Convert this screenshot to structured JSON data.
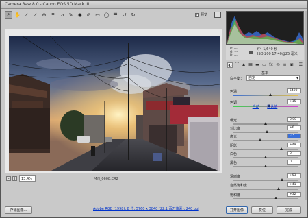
{
  "window": {
    "title": "Camera Raw 8.0  -  Canon EOS 5D Mark III"
  },
  "toolbar": {
    "tools": [
      "zoom-icon",
      "hand-icon",
      "white-balance-icon",
      "color-sampler-icon",
      "target-adjust-icon",
      "crop-icon",
      "straighten-icon",
      "spot-removal-icon",
      "red-eye-icon",
      "adjustment-brush-icon",
      "graduated-filter-icon",
      "radial-filter-icon",
      "preferences-icon",
      "rotate-left-icon",
      "rotate-right-icon"
    ],
    "preview_label": "预览",
    "preview_checked": "✓"
  },
  "preview": {
    "zoom": "13.4%",
    "zoom_minus": "-",
    "zoom_plus": "+",
    "filename": "MYJ_0608.CR2"
  },
  "readout": {
    "r": "R: ---",
    "g": "G: ---",
    "b": "B: ---",
    "line1": "f/4   1/640 秒",
    "line2": "ISO 200   17-40@25 毫米"
  },
  "panel": {
    "menu_icon": "☰",
    "title": "基本",
    "wb_label": "白平衡：",
    "wb_value": "自定",
    "links": {
      "auto": "自动",
      "default": "默认值"
    },
    "sliders": [
      {
        "label": "色温",
        "value": "5400",
        "pos": 0.58
      },
      {
        "label": "色调",
        "value": "+15",
        "pos": 0.56
      },
      {
        "label": "曝光",
        "value": "0.00",
        "pos": 0.5
      },
      {
        "label": "对比度",
        "value": "+6",
        "pos": 0.53
      },
      {
        "label": "高光",
        "value": "-15",
        "pos": 0.42
      },
      {
        "label": "阴影",
        "value": "+49",
        "pos": 0.74
      },
      {
        "label": "白色",
        "value": "0",
        "pos": 0.5
      },
      {
        "label": "黑色",
        "value": "0",
        "pos": 0.5
      },
      {
        "label": "清晰度",
        "value": "+53",
        "pos": 0.76
      },
      {
        "label": "自然饱和度",
        "value": "+41",
        "pos": 0.7
      },
      {
        "label": "饱和度",
        "value": "+32",
        "pos": 0.66
      }
    ]
  },
  "footer": {
    "save": "存储图像...",
    "workflow": "Adobe RGB (1998); 8 位; 5760 x 3840 (22.1 百万像素); 240 ppi",
    "open": "打开图像",
    "reset": "复位",
    "done": "完成"
  },
  "colors": {
    "accent": "#3a6fd8",
    "link": "#0033cc"
  }
}
